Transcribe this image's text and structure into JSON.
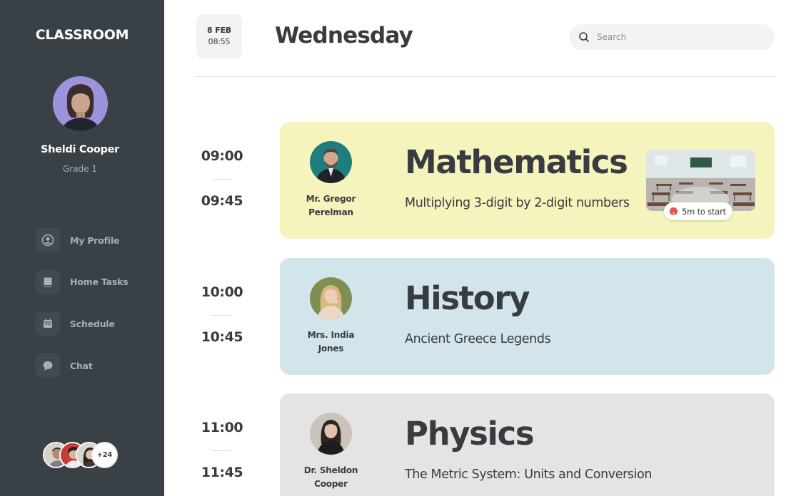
{
  "app": {
    "brand": "CLASSROOM"
  },
  "user": {
    "name": "Sheldi Cooper",
    "grade": "Grade 1"
  },
  "nav": [
    {
      "label": "My Profile",
      "icon": "user-circle-icon"
    },
    {
      "label": "Home Tasks",
      "icon": "book-icon"
    },
    {
      "label": "Schedule",
      "icon": "calendar-icon"
    },
    {
      "label": "Chat",
      "icon": "chat-bubble-icon"
    }
  ],
  "peers": {
    "more_label": "+24"
  },
  "header": {
    "date": "8 FEB",
    "time": "08:55",
    "title": "Wednesday",
    "search_placeholder": "Search"
  },
  "lessons": [
    {
      "start": "09:00",
      "end": "09:45",
      "teacher": [
        "Mr. Gregor",
        "Perelman"
      ],
      "subject": "Mathematics",
      "topic": "Multiplying 3-digit by 2-digit numbers",
      "color": "#f5f4bd",
      "badge": "5m to start"
    },
    {
      "start": "10:00",
      "end": "10:45",
      "teacher": [
        "Mrs. India",
        "Jones"
      ],
      "subject": "History",
      "topic": "Ancient Greece Legends",
      "color": "#d2e5eb"
    },
    {
      "start": "11:00",
      "end": "11:45",
      "teacher": [
        "Dr. Sheldon",
        "Cooper"
      ],
      "subject": "Physics",
      "topic": "The Metric System: Units and Conversion",
      "color": "#e6e3e3"
    }
  ],
  "colors": {
    "sidebar": "#394046",
    "text": "#383b40",
    "badge_dot": "#e4534c"
  }
}
